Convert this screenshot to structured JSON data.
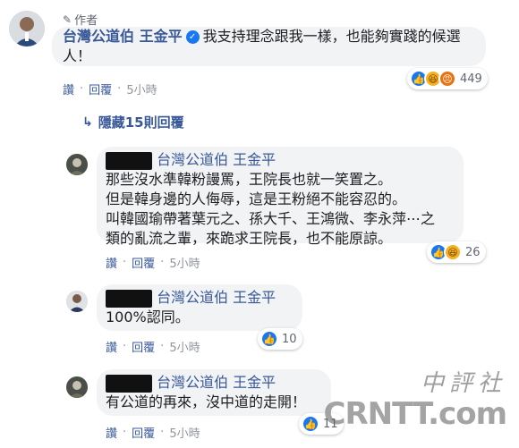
{
  "top_comment": {
    "author_tag": "作者",
    "author_name": "台灣公道伯 王金平",
    "text": "我支持理念跟我一樣，也能夠實踐的候選人！",
    "actions": {
      "like": "讚",
      "reply": "回覆",
      "time": "5小時"
    },
    "reaction_count": "449",
    "reaction_icons": [
      "like-icon",
      "haha-icon",
      "angry-icon"
    ]
  },
  "hidden_replies_label": "隱藏15則回覆",
  "replies": [
    {
      "mentioned_page": "台灣公道伯 王金平",
      "text_lines": [
        "那些沒水準韓粉謾罵，王院長也就一笑置之。",
        "但是韓身邊的人侮辱，這是王粉絕不能容忍的。",
        "叫韓國瑜帶著葉元之、孫大千、王鴻微、李永萍⋯之",
        "類的亂流之輩，來跪求王院長，也不能原諒。"
      ],
      "actions": {
        "like": "讚",
        "reply": "回覆",
        "time": "5小時"
      },
      "reaction_count": "26",
      "reaction_icons": [
        "like-icon",
        "haha-icon"
      ]
    },
    {
      "mentioned_page": "台灣公道伯 王金平",
      "text_lines": [
        "100%認同。"
      ],
      "actions": {
        "like": "讚",
        "reply": "回覆",
        "time": "5小時"
      },
      "reaction_count": "10",
      "reaction_icons": [
        "like-icon"
      ]
    },
    {
      "mentioned_page": "台灣公道伯 王金平",
      "text_lines": [
        "有公道的再來，沒中道的走開！"
      ],
      "actions": {
        "like": "讚",
        "reply": "回覆",
        "time": "5小時"
      },
      "reaction_count": "11",
      "reaction_icons": [
        "like-icon"
      ]
    }
  ],
  "watermark": {
    "chinese": "中評社",
    "latin": "CRNTT.com"
  },
  "colors": {
    "link": "#385898",
    "bubble": "#f2f3f5",
    "like": "#1877f2",
    "meta": "#90949c"
  }
}
